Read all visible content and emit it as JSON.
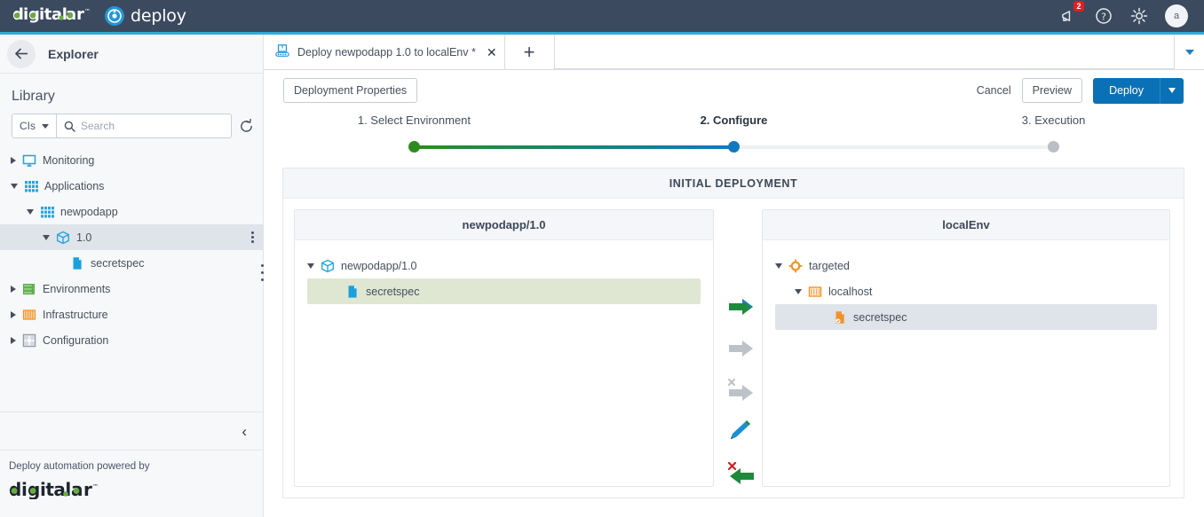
{
  "topbar": {
    "brand_primary": "digital",
    "brand_dot": ".",
    "brand_ai": "ai",
    "brand_tm": "™",
    "product": "deploy",
    "product_tm": "™",
    "notification_count": "2",
    "avatar_initial": "a",
    "icons": {
      "announcement": "megaphone-icon",
      "help": "help-circle-icon",
      "settings": "gear-icon"
    }
  },
  "sidebar": {
    "back_label": "←",
    "header_title": "Explorer",
    "library_title": "Library",
    "filter_label": "CIs",
    "search_placeholder": "Search",
    "search_value": "",
    "refresh_label": "refresh",
    "tree": [
      {
        "label": "Monitoring",
        "depth": 0,
        "expanded": false,
        "icon": "monitor-icon",
        "selected": false,
        "kebab": false
      },
      {
        "label": "Applications",
        "depth": 0,
        "expanded": true,
        "icon": "grid-blue-icon",
        "selected": false,
        "kebab": false
      },
      {
        "label": "newpodapp",
        "depth": 1,
        "expanded": true,
        "icon": "grid-blue-icon",
        "selected": false,
        "kebab": false
      },
      {
        "label": "1.0",
        "depth": 2,
        "expanded": true,
        "icon": "package-icon",
        "selected": true,
        "kebab": true
      },
      {
        "label": "secretspec",
        "depth": 3,
        "expanded": null,
        "icon": "file-blue-icon",
        "selected": false,
        "kebab": false
      },
      {
        "label": "Environments",
        "depth": 0,
        "expanded": false,
        "icon": "servers-green-icon",
        "selected": false,
        "kebab": false
      },
      {
        "label": "Infrastructure",
        "depth": 0,
        "expanded": false,
        "icon": "grid-orange-icon",
        "selected": false,
        "kebab": false
      },
      {
        "label": "Configuration",
        "depth": 0,
        "expanded": false,
        "icon": "gear-gray-icon",
        "selected": false,
        "kebab": false
      }
    ],
    "collapse_label": "‹",
    "powered_text": "Deploy automation powered by",
    "powered_logo": "digital.ai"
  },
  "tabs": {
    "items": [
      {
        "label": "Deploy newpodapp 1.0 to localEnv *",
        "icon": "deployment-package-icon",
        "active": true,
        "close": "✕"
      }
    ],
    "add_label": "+",
    "more_label": "chevron-down"
  },
  "toolbar": {
    "deployment_properties_label": "Deployment Properties",
    "cancel_label": "Cancel",
    "preview_label": "Preview",
    "deploy_label": "Deploy",
    "deploy_dropdown_label": "deploy-options"
  },
  "stepper": {
    "steps": [
      {
        "label": "1. Select Environment",
        "state": "done",
        "color": "#2e8b1f",
        "pos_pct": 16
      },
      {
        "label": "2. Configure",
        "state": "current",
        "color": "#1179bd",
        "pos_pct": 50
      },
      {
        "label": "3. Execution",
        "state": "todo",
        "color": "#b9bfc7",
        "pos_pct": 84
      }
    ]
  },
  "deployment": {
    "header": "INITIAL DEPLOYMENT",
    "source_panel": {
      "title": "newpodapp/1.0",
      "rows": [
        {
          "label": "newpodapp/1.0",
          "depth": 0,
          "expanded": true,
          "icon": "package-icon",
          "highlight": "none"
        },
        {
          "label": "secretspec",
          "depth": 1,
          "expanded": null,
          "icon": "file-blue-icon",
          "highlight": "green"
        }
      ]
    },
    "target_panel": {
      "title": "localEnv",
      "rows": [
        {
          "label": "targeted",
          "depth": 0,
          "expanded": true,
          "icon": "target-orange-icon",
          "highlight": "none"
        },
        {
          "label": "localhost",
          "depth": 1,
          "expanded": true,
          "icon": "bars-orange-icon",
          "highlight": "none"
        },
        {
          "label": "secretspec",
          "depth": 2,
          "expanded": null,
          "icon": "file-orange-icon",
          "highlight": "blue"
        }
      ]
    },
    "actions": [
      {
        "name": "add-deployed-arrow",
        "icon": "arrow-right-green-blue-icon",
        "enabled": true
      },
      {
        "name": "modify-deployed-arrow",
        "icon": "arrow-right-gray-icon",
        "enabled": false
      },
      {
        "name": "remove-deployed-arrow",
        "icon": "arrow-right-gray-x-icon",
        "enabled": false
      },
      {
        "name": "edit-deployed-pencil",
        "icon": "pencil-blue-icon",
        "enabled": true
      },
      {
        "name": "undo-deployed-arrow",
        "icon": "arrow-left-green-x-icon",
        "enabled": true
      }
    ]
  }
}
